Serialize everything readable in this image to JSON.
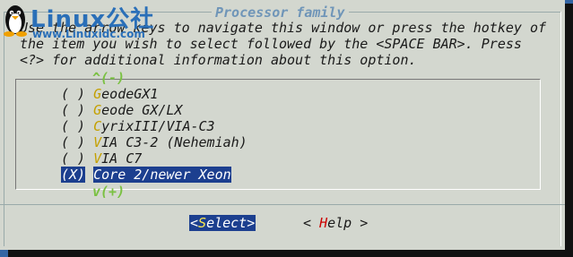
{
  "dialog": {
    "title": "Processor family",
    "help_lines": [
      "Use the arrow keys to navigate this window or press the hotkey of",
      "the item you wish to select followed by the <SPACE BAR>. Press",
      "<?> for additional information about this option."
    ]
  },
  "list": {
    "scroll_up": "^(-)",
    "scroll_down": "v(+)",
    "items": [
      {
        "mark": "( )",
        "hotkey": "G",
        "rest": "eodeGX1",
        "selected": false
      },
      {
        "mark": "( )",
        "hotkey": "G",
        "rest": "eode GX/LX",
        "selected": false
      },
      {
        "mark": "( )",
        "hotkey": "C",
        "rest": "yrixIII/VIA-C3",
        "selected": false
      },
      {
        "mark": "( )",
        "hotkey": "V",
        "rest": "IA C3-2 (Nehemiah)",
        "selected": false
      },
      {
        "mark": "( )",
        "hotkey": "V",
        "rest": "IA C7",
        "selected": false
      },
      {
        "mark": "(X)",
        "hotkey": "C",
        "rest": "ore 2/newer Xeon",
        "selected": true
      }
    ]
  },
  "buttons": {
    "select": {
      "left": "<",
      "hotkey": "S",
      "rest": "elect>"
    },
    "help": {
      "left": "< ",
      "hotkey": "H",
      "rest": "elp >"
    }
  },
  "watermark": {
    "brand": "Linux公社",
    "site": "www.Linuxidc.com"
  },
  "colors": {
    "background": "#3465a4",
    "dialog": "#d3d7cf",
    "selection": "#1c3f8f",
    "hotkey": "#c4a000",
    "arrows": "#7ac142",
    "title": "#6f95b8"
  }
}
